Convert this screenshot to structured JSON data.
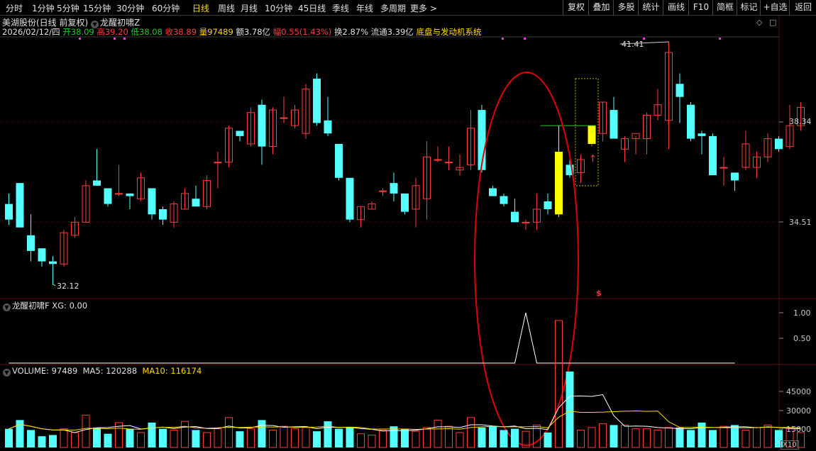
{
  "toolbar": {
    "periods": [
      "分时",
      "1分钟",
      "5分钟",
      "15分钟",
      "30分钟",
      "60分钟",
      "日线",
      "周线",
      "月线",
      "10分钟",
      "45日线",
      "季线",
      "年线",
      "多周期",
      "更多 >"
    ],
    "active_period": "日线",
    "right_buttons": [
      "复权",
      "叠加",
      "多股",
      "统计",
      "画线",
      "F10",
      "简框",
      "标记",
      "+自选",
      "返回"
    ]
  },
  "stock": {
    "name_line": "美湖股份(日线 前复权)",
    "indicator_name": "龙醒初啸Z",
    "date": "2026/02/12/四",
    "open_label": "开",
    "open": "38.09",
    "high_label": "高",
    "high": "39.20",
    "low_label": "低",
    "low": "38.08",
    "close_label": "收",
    "close": "38.89",
    "vol_label": "量",
    "vol": "97489",
    "amount_label": "额",
    "amount": "3.78亿",
    "chg_label": "幅",
    "chg": "0.55(1.43%)",
    "turnover_label": "换",
    "turnover": "2.87%",
    "float_label": "流通",
    "float": "3.39亿",
    "system": "底盘与发动机系统"
  },
  "main_chart": {
    "ylabels": [
      "38.34",
      "34.51"
    ],
    "high_mark": "41.41",
    "low_mark": "32.12",
    "signal_glyph": "$",
    "colors": {
      "up": "#ff3c3c",
      "down": "#54ffff",
      "highlight": "#ffff00"
    }
  },
  "indicator_pane": {
    "label": "龙醒初啸F  XG: 0.00",
    "ylabels": [
      "1.00",
      "0.50"
    ],
    "xg_values": [
      0,
      0,
      0,
      0,
      0,
      0,
      0,
      0,
      0,
      0,
      0,
      0,
      0,
      0,
      0,
      0,
      0,
      0,
      0,
      0,
      0,
      0,
      0,
      0,
      0,
      0,
      0,
      0,
      0,
      0,
      0,
      0,
      0,
      0,
      0,
      0,
      0,
      0,
      0,
      0,
      0,
      0,
      0,
      0,
      0,
      0,
      0,
      1,
      0,
      0,
      0,
      0,
      0,
      0,
      0,
      0,
      0,
      0,
      0,
      0,
      0,
      0,
      0,
      0,
      0,
      0,
      0
    ]
  },
  "volume_pane": {
    "label_vol": "VOLUME: 97489",
    "label_ma5": "MA5: 120288",
    "label_ma10": "MA10: 116174",
    "ylabels": [
      "45000",
      "30000",
      "15000"
    ],
    "multiplier": "X10"
  },
  "chart_data": {
    "type": "candlestick",
    "candles": [
      {
        "o": 35.2,
        "h": 35.6,
        "l": 34.4,
        "c": 34.6
      },
      {
        "o": 36.0,
        "h": 36.0,
        "l": 34.3,
        "c": 34.3
      },
      {
        "o": 34.0,
        "h": 34.8,
        "l": 33.0,
        "c": 33.4
      },
      {
        "o": 33.5,
        "h": 33.5,
        "l": 32.8,
        "c": 33.0
      },
      {
        "o": 33.0,
        "h": 33.2,
        "l": 32.1,
        "c": 32.9
      },
      {
        "o": 32.9,
        "h": 34.2,
        "l": 32.8,
        "c": 34.1
      },
      {
        "o": 34.0,
        "h": 34.7,
        "l": 33.9,
        "c": 34.5
      },
      {
        "o": 34.5,
        "h": 36.1,
        "l": 34.5,
        "c": 35.9
      },
      {
        "o": 36.1,
        "h": 37.3,
        "l": 35.9,
        "c": 35.9
      },
      {
        "o": 35.8,
        "h": 35.8,
        "l": 35.1,
        "c": 35.2
      },
      {
        "o": 35.6,
        "h": 36.7,
        "l": 35.5,
        "c": 35.6
      },
      {
        "o": 35.6,
        "h": 35.6,
        "l": 35.0,
        "c": 35.5
      },
      {
        "o": 35.4,
        "h": 36.4,
        "l": 35.3,
        "c": 36.2
      },
      {
        "o": 35.8,
        "h": 35.8,
        "l": 34.6,
        "c": 34.8
      },
      {
        "o": 35.0,
        "h": 35.1,
        "l": 34.4,
        "c": 34.6
      },
      {
        "o": 34.5,
        "h": 35.3,
        "l": 34.3,
        "c": 35.2
      },
      {
        "o": 35.0,
        "h": 35.8,
        "l": 35.0,
        "c": 35.6
      },
      {
        "o": 35.4,
        "h": 35.9,
        "l": 35.2,
        "c": 35.1
      },
      {
        "o": 35.1,
        "h": 36.3,
        "l": 35.0,
        "c": 36.1
      },
      {
        "o": 36.8,
        "h": 37.2,
        "l": 35.8,
        "c": 36.8
      },
      {
        "o": 36.8,
        "h": 38.2,
        "l": 36.6,
        "c": 38.1
      },
      {
        "o": 38.0,
        "h": 38.0,
        "l": 37.6,
        "c": 37.8
      },
      {
        "o": 37.5,
        "h": 38.9,
        "l": 37.4,
        "c": 38.7
      },
      {
        "o": 39.0,
        "h": 39.2,
        "l": 36.7,
        "c": 37.4
      },
      {
        "o": 37.4,
        "h": 38.9,
        "l": 37.1,
        "c": 38.8
      },
      {
        "o": 38.5,
        "h": 39.3,
        "l": 38.3,
        "c": 38.5
      },
      {
        "o": 38.2,
        "h": 39.0,
        "l": 38.1,
        "c": 38.8
      },
      {
        "o": 37.9,
        "h": 39.8,
        "l": 37.7,
        "c": 39.6
      },
      {
        "o": 40.0,
        "h": 40.2,
        "l": 38.2,
        "c": 38.3
      },
      {
        "o": 38.4,
        "h": 39.3,
        "l": 37.8,
        "c": 37.9
      },
      {
        "o": 37.5,
        "h": 37.5,
        "l": 36.1,
        "c": 36.2
      },
      {
        "o": 36.2,
        "h": 36.2,
        "l": 34.5,
        "c": 34.6
      },
      {
        "o": 34.6,
        "h": 35.1,
        "l": 34.3,
        "c": 35.1
      },
      {
        "o": 35.0,
        "h": 35.3,
        "l": 35.0,
        "c": 35.2
      },
      {
        "o": 35.7,
        "h": 35.8,
        "l": 35.5,
        "c": 35.7
      },
      {
        "o": 36.0,
        "h": 36.4,
        "l": 35.3,
        "c": 35.6
      },
      {
        "o": 35.6,
        "h": 35.6,
        "l": 34.8,
        "c": 34.9
      },
      {
        "o": 35.0,
        "h": 36.2,
        "l": 34.3,
        "c": 35.9
      },
      {
        "o": 35.4,
        "h": 37.6,
        "l": 34.6,
        "c": 37.0
      },
      {
        "o": 36.9,
        "h": 37.4,
        "l": 36.8,
        "c": 36.9
      },
      {
        "o": 36.8,
        "h": 37.4,
        "l": 36.5,
        "c": 36.8
      },
      {
        "o": 36.5,
        "h": 37.1,
        "l": 36.3,
        "c": 36.6
      },
      {
        "o": 36.7,
        "h": 38.8,
        "l": 36.5,
        "c": 38.1
      },
      {
        "o": 38.8,
        "h": 39.0,
        "l": 36.4,
        "c": 36.5
      },
      {
        "o": 35.8,
        "h": 35.9,
        "l": 35.5,
        "c": 35.5
      },
      {
        "o": 35.5,
        "h": 35.6,
        "l": 35.1,
        "c": 35.2
      },
      {
        "o": 34.9,
        "h": 35.4,
        "l": 34.5,
        "c": 34.5
      },
      {
        "o": 34.5,
        "h": 34.6,
        "l": 34.2,
        "c": 34.5
      },
      {
        "o": 34.5,
        "h": 35.6,
        "l": 34.2,
        "c": 35.0
      },
      {
        "o": 35.3,
        "h": 35.6,
        "l": 34.8,
        "c": 35.0
      },
      {
        "o": 34.8,
        "h": 38.2,
        "l": 34.7,
        "c": 37.2
      },
      {
        "o": 36.7,
        "h": 36.9,
        "l": 36.2,
        "c": 36.3
      },
      {
        "o": 36.4,
        "h": 37.1,
        "l": 36.0,
        "c": 36.9
      },
      {
        "o": 37.8,
        "h": 38.2,
        "l": 37.4,
        "c": 38.2
      },
      {
        "o": 37.9,
        "h": 39.1,
        "l": 37.6,
        "c": 39.1
      },
      {
        "o": 38.8,
        "h": 39.3,
        "l": 37.7,
        "c": 37.7
      },
      {
        "o": 37.3,
        "h": 37.8,
        "l": 36.8,
        "c": 37.7
      },
      {
        "o": 37.7,
        "h": 37.8,
        "l": 37.1,
        "c": 37.9
      },
      {
        "o": 37.7,
        "h": 38.7,
        "l": 37.1,
        "c": 38.6
      },
      {
        "o": 38.6,
        "h": 39.6,
        "l": 38.4,
        "c": 39.0
      },
      {
        "o": 38.4,
        "h": 41.4,
        "l": 37.3,
        "c": 41.0
      },
      {
        "o": 39.8,
        "h": 40.2,
        "l": 38.3,
        "c": 39.3
      },
      {
        "o": 39.0,
        "h": 39.1,
        "l": 37.6,
        "c": 37.7
      },
      {
        "o": 37.9,
        "h": 38.0,
        "l": 37.1,
        "c": 37.8
      },
      {
        "o": 37.8,
        "h": 37.9,
        "l": 36.3,
        "c": 36.3
      },
      {
        "o": 36.6,
        "h": 37.0,
        "l": 35.9,
        "c": 36.6
      },
      {
        "o": 36.4,
        "h": 36.4,
        "l": 35.7,
        "c": 36.1
      },
      {
        "o": 36.6,
        "h": 38.0,
        "l": 36.5,
        "c": 37.5
      },
      {
        "o": 36.6,
        "h": 37.2,
        "l": 36.2,
        "c": 37.0
      },
      {
        "o": 37.0,
        "h": 37.9,
        "l": 36.8,
        "c": 37.7
      },
      {
        "o": 37.7,
        "h": 37.8,
        "l": 37.2,
        "c": 37.3
      },
      {
        "o": 37.4,
        "h": 39.0,
        "l": 37.3,
        "c": 38.2
      },
      {
        "o": 38.2,
        "h": 39.1,
        "l": 38.0,
        "c": 38.9
      }
    ],
    "volumes": [
      1500,
      2200,
      1400,
      900,
      1000,
      1500,
      1200,
      2600,
      1600,
      1100,
      2000,
      1500,
      1200,
      2000,
      1500,
      1400,
      2100,
      1400,
      1200,
      1500,
      2400,
      1300,
      1500,
      2200,
      1400,
      1700,
      1500,
      1600,
      1300,
      2100,
      1500,
      1600,
      1100,
      1000,
      1400,
      1700,
      1500,
      1300,
      1600,
      2200,
      1700,
      1200,
      2400,
      1600,
      1700,
      1400,
      1500,
      1300,
      1800,
      1200,
      2100,
      1300,
      1400,
      1600,
      1900,
      1800,
      1800,
      1500,
      1500,
      1400,
      1600,
      1600,
      1400,
      2000,
      1400,
      1700,
      1800,
      1400,
      1600,
      1800,
      1400,
      1500,
      1200
    ],
    "ma5": [],
    "ma10": []
  }
}
